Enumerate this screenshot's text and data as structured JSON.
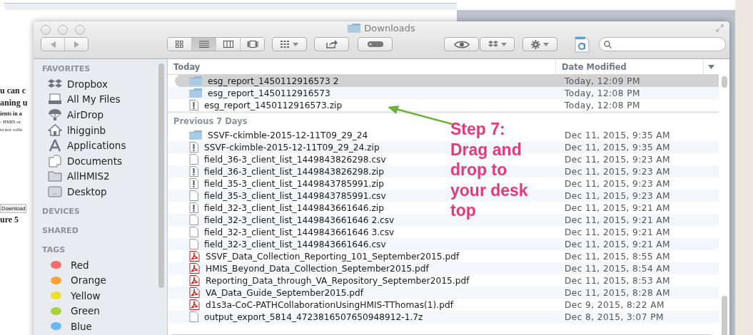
{
  "background_document": {
    "fragments": [
      {
        "text": "u can c",
        "kind": "body"
      },
      {
        "text": "aning u",
        "kind": "body"
      },
      {
        "text": "ients in a",
        "kind": "heading"
      },
      {
        "text": "- HMIS or",
        "kind": "small"
      },
      {
        "text": "ta not colle",
        "kind": "small"
      },
      {
        "text": "Download",
        "kind": "button"
      },
      {
        "text": "ure 5",
        "kind": "body"
      }
    ]
  },
  "window": {
    "title": "Downloads"
  },
  "toolbar": {
    "view_modes": [
      {
        "kind": "icons",
        "selected": false
      },
      {
        "kind": "list",
        "selected": true
      },
      {
        "kind": "columns",
        "selected": false
      },
      {
        "kind": "coverflow",
        "selected": false
      }
    ]
  },
  "sidebar": {
    "sections": [
      {
        "title": "FAVORITES",
        "items": [
          {
            "label": "Dropbox",
            "kind": "dropbox"
          },
          {
            "label": "All My Files",
            "kind": "allfiles"
          },
          {
            "label": "AirDrop",
            "kind": "airdrop"
          },
          {
            "label": "lhigginb",
            "kind": "home"
          },
          {
            "label": "Applications",
            "kind": "apps"
          },
          {
            "label": "Documents",
            "kind": "documents"
          },
          {
            "label": "AllHMIS2",
            "kind": "folder"
          },
          {
            "label": "Desktop",
            "kind": "desktop"
          }
        ]
      },
      {
        "title": "DEVICES"
      },
      {
        "title": "SHARED"
      },
      {
        "title": "TAGS",
        "items": [
          {
            "label": "Red",
            "kind": "tag",
            "color": "#f26d6d"
          },
          {
            "label": "Orange",
            "kind": "tag",
            "color": "#f7a731"
          },
          {
            "label": "Yellow",
            "kind": "tag",
            "color": "#f0de2c"
          },
          {
            "label": "Green",
            "kind": "tag",
            "color": "#a4d33a"
          },
          {
            "label": "Blue",
            "kind": "tag",
            "color": "#6ab6f7"
          }
        ]
      }
    ]
  },
  "file_list": {
    "columns": [
      "Today",
      "Date Modified"
    ],
    "groups": [
      {
        "files": [
          {
            "name": "esg_report_1450112916573 2",
            "date": "Today, 12:09 PM",
            "kind": "folder",
            "selected": true
          },
          {
            "name": "esg_report_1450112916573",
            "date": "Today, 12:08 PM",
            "kind": "folder",
            "selected": false
          },
          {
            "name": "esg_report_1450112916573.zip",
            "date": "Today, 12:08 PM",
            "kind": "zip",
            "selected": false
          }
        ]
      },
      {
        "title": "Previous 7 Days",
        "files": [
          {
            "name": "SSVF-ckimble-2015-12-11T09_29_24",
            "date": "Dec 11, 2015, 9:35 AM",
            "kind": "folder",
            "selected": false
          },
          {
            "name": "SSVF-ckimble-2015-12-11T09_29_24.zip",
            "date": "Dec 11, 2015, 9:35 AM",
            "kind": "zip",
            "selected": false
          },
          {
            "name": "field_36-3_client_list_1449843826298.csv",
            "date": "Dec 11, 2015, 9:23 AM",
            "kind": "doc",
            "selected": false
          },
          {
            "name": "field_36-3_client_list_1449843826298.zip",
            "date": "Dec 11, 2015, 9:23 AM",
            "kind": "zip",
            "selected": false
          },
          {
            "name": "field_35-3_client_list_1449843785991.zip",
            "date": "Dec 11, 2015, 9:23 AM",
            "kind": "zip",
            "selected": false
          },
          {
            "name": "field_35-3_client_list_1449843785991.csv",
            "date": "Dec 11, 2015, 9:23 AM",
            "kind": "doc",
            "selected": false
          },
          {
            "name": "field_32-3_client_list_1449843661646.zip",
            "date": "Dec 11, 2015, 9:21 AM",
            "kind": "zip",
            "selected": false
          },
          {
            "name": "field_32-3_client_list_1449843661646 2.csv",
            "date": "Dec 11, 2015, 9:21 AM",
            "kind": "doc",
            "selected": false
          },
          {
            "name": "field_32-3_client_list_1449843661646 3.csv",
            "date": "Dec 11, 2015, 9:21 AM",
            "kind": "doc",
            "selected": false
          },
          {
            "name": "field_32-3_client_list_1449843661646.csv",
            "date": "Dec 11, 2015, 9:21 AM",
            "kind": "doc",
            "selected": false
          },
          {
            "name": "SSVF_Data_Collection_Reporting_101_September2015.pdf",
            "date": "Dec 11, 2015, 8:55 AM",
            "kind": "pdf",
            "selected": false
          },
          {
            "name": "HMIS_Beyond_Data_Collection_September2015.pdf",
            "date": "Dec 11, 2015, 8:54 AM",
            "kind": "pdf",
            "selected": false
          },
          {
            "name": "Reporting_Data_through_VA_Repository_September2015.pdf",
            "date": "Dec 11, 2015, 8:53 AM",
            "kind": "pdf",
            "selected": false
          },
          {
            "name": "VA_Data_Guide_September2015.pdf",
            "date": "Dec 11, 2015, 8:28 AM",
            "kind": "pdf",
            "selected": false
          },
          {
            "name": "d1s3a-CoC-PATHCollaborationUsingHMIS-TThomas(1).pdf",
            "date": "Dec 9, 2015, 8:22 AM",
            "kind": "pdf",
            "selected": false
          },
          {
            "name": "output_export_5814_4723816507650948912-1.7z",
            "date": "Dec 8, 2015, 3:07 PM",
            "kind": "doc",
            "selected": false
          }
        ]
      }
    ]
  },
  "annotation": {
    "text": "Step 7:\nDrag and\ndrop to\nyour desk\ntop"
  }
}
